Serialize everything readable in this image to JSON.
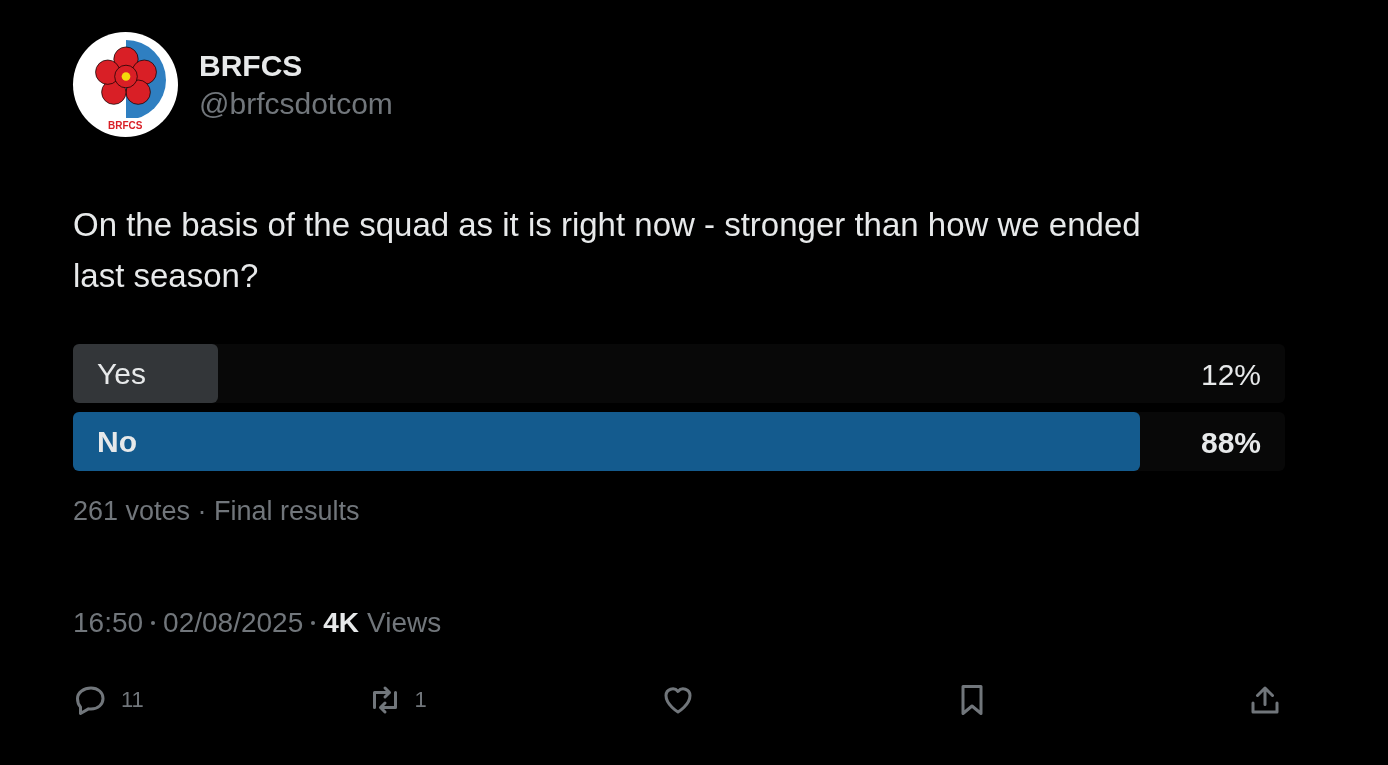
{
  "author": {
    "name": "BRFCS",
    "handle": "@brfcsdotcom",
    "logo_text": "BRFCS"
  },
  "text": "On the basis of the squad as it is right now - stronger than how we ended last season?",
  "poll": {
    "options": [
      {
        "label": "Yes",
        "percent": "12%",
        "level": 0.12,
        "winner": false
      },
      {
        "label": "No",
        "percent": "88%",
        "level": 0.88,
        "winner": true
      }
    ],
    "meta": "261 votes · Final results"
  },
  "timestamp": {
    "time": "16:50",
    "date": "02/08/2025",
    "views_count": "4K",
    "views_label": "Views"
  },
  "actions": [
    {
      "kind": "reply",
      "count": "11"
    },
    {
      "kind": "repost",
      "count": "1"
    },
    {
      "kind": "like"
    },
    {
      "kind": "bookmark"
    },
    {
      "kind": "share"
    }
  ]
}
